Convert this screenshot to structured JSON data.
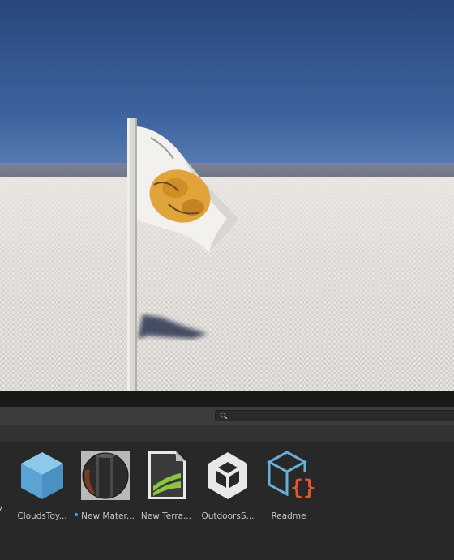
{
  "project_browser": {
    "search": {
      "placeholder": ""
    },
    "partial_label": "y",
    "assets": [
      {
        "label": "CloudsToy...",
        "icon": "prefab-cube-icon",
        "color": "#6aaed8"
      },
      {
        "label": "New Mater...",
        "icon": "material-sphere-icon",
        "dirty": true
      },
      {
        "label": "New Terra...",
        "icon": "terrain-data-icon",
        "color": "#8cc63f"
      },
      {
        "label": "OutdoorsS...",
        "icon": "unity-scene-icon",
        "color": "#e6e6e6"
      },
      {
        "label": "Readme",
        "icon": "script-braces-icon",
        "color": "#e2572b"
      }
    ]
  },
  "colors": {
    "sky_top": "#27467a",
    "horizon": "#7d8394",
    "ground": "#e6e3df",
    "panel_bg": "#282828",
    "toolbar_bg": "#3c3c3c",
    "label_text": "#c4c4c4"
  }
}
